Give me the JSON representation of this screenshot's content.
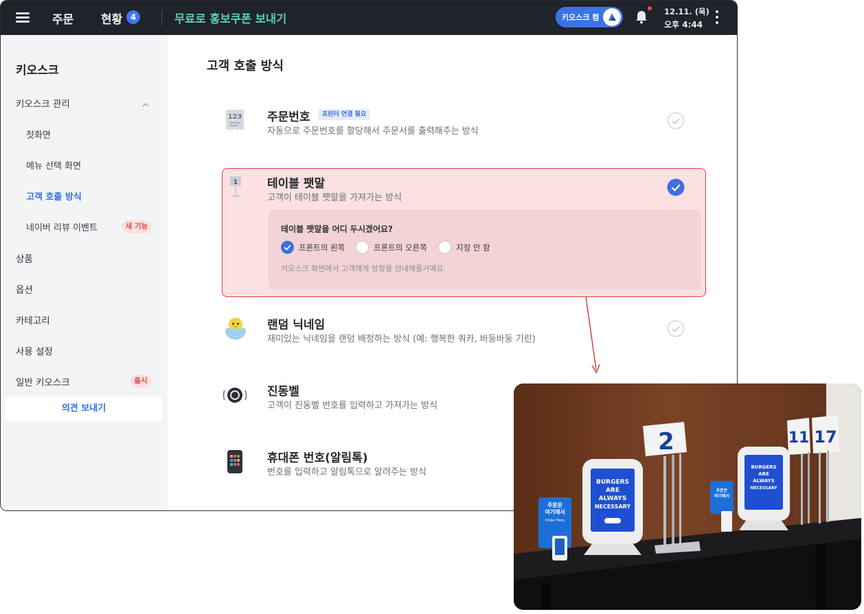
{
  "topbar": {
    "order_tab": "주문",
    "status_tab": "현황",
    "status_badge": "4",
    "title": "무료로 홍보쿠폰 보내기",
    "kiosk_button": "키오스크 켬",
    "date": "12.11. (목)",
    "time": "오후 4:44"
  },
  "sidebar": {
    "title": "키오스크",
    "group_label": "키오스크 관리",
    "sub_items": [
      "첫화면",
      "메뉴 선택 화면",
      "고객 호출 방식",
      "네이버 리뷰 이벤트"
    ],
    "new_feature_tag": "새 기능",
    "items": [
      "상품",
      "옵션",
      "카테고리",
      "사용 설정",
      "일반 키오스크"
    ],
    "launch_tag": "출시",
    "feedback_button": "의견 보내기"
  },
  "main": {
    "title": "고객 호출 방식",
    "options": [
      {
        "title": "주문번호",
        "badge": "프린터 연결 필요",
        "desc": "자동으로 주문번호를 할당해서 주문서를 출력해주는 방식",
        "icon": "receipt-icon",
        "icon_text": "123"
      },
      {
        "title": "테이블 팻말",
        "desc": "고객이 테이블 팻말을 가져가는 방식",
        "icon": "table-sign-icon",
        "icon_text": "1"
      },
      {
        "title": "랜덤 닉네임",
        "desc": "재미있는 닉네임을 랜덤 배정하는 방식 (예: 행복한 쿼카, 바둥바둥 기린)",
        "icon": "chick-icon"
      },
      {
        "title": "진동벨",
        "desc": "고객이 진동벨 번호를 입력하고 가져가는 방식",
        "icon": "vibration-bell-icon"
      },
      {
        "title": "휴대폰 번호(알림톡)",
        "desc": "번호를 입력하고 알림톡으로 알려주는 방식",
        "icon": "phone-icon"
      }
    ],
    "sign_question": "테이블 팻말을 어디 두시겠어요?",
    "radio_options": [
      "프론트의 왼쪽",
      "프론트의 오른쪽",
      "지정 안 함"
    ],
    "selected_radio": 0,
    "hint": "키오스크 화면에서 고객에게 방향을 안내해줄거예요."
  },
  "photo": {
    "sign_numbers": [
      "2",
      "11",
      "17"
    ],
    "kiosk_screen_text": [
      "BURGERS",
      "ARE",
      "ALWAYS",
      "NECESSARY"
    ],
    "stand_text": [
      "주문은",
      "여기에서",
      "Order Here"
    ]
  },
  "colors": {
    "topbar_bg": "#1f232a",
    "accent_blue": "#3f6fe0",
    "accent_teal": "#58d0b3",
    "highlight_red": "#e53b3b"
  }
}
